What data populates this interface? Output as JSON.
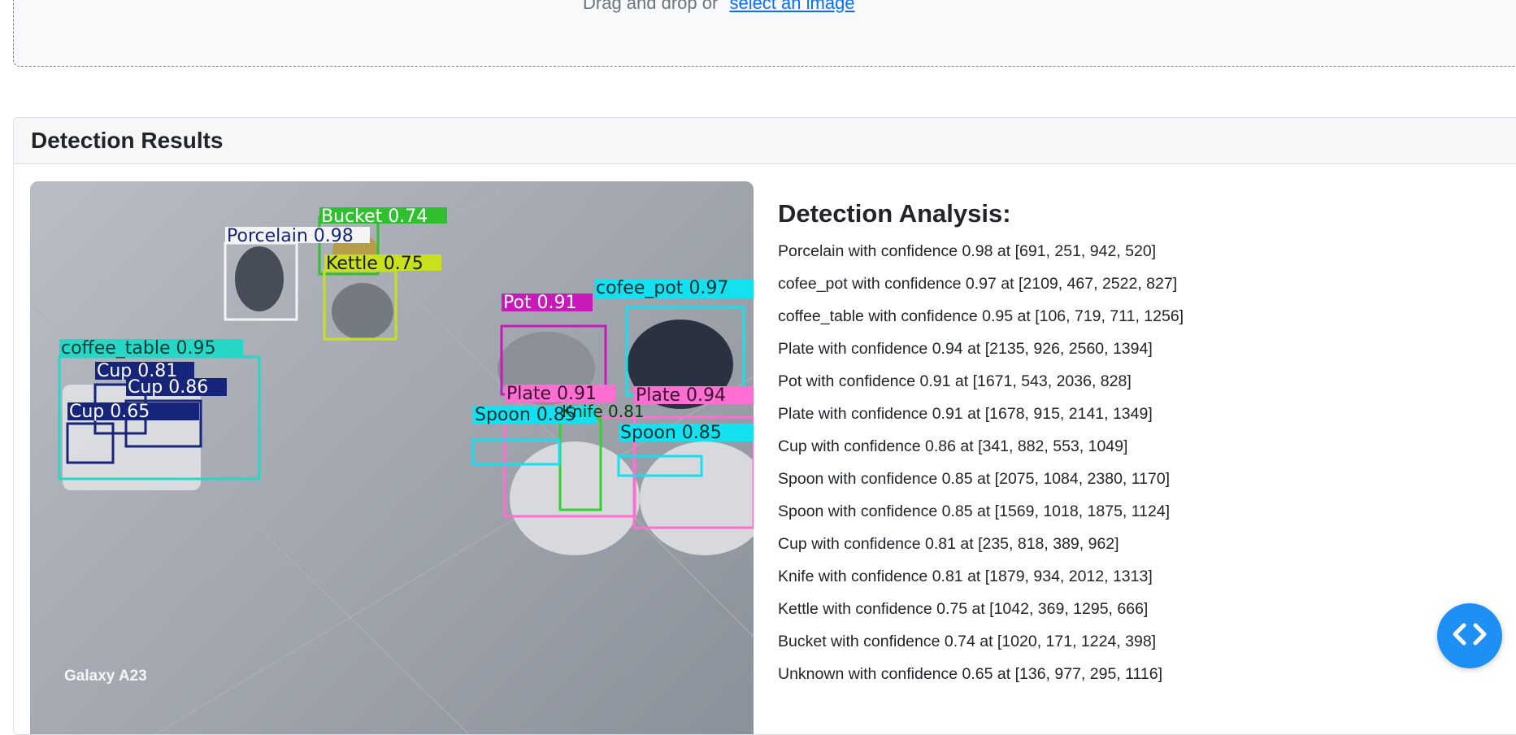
{
  "upload": {
    "text": "Drag and drop or",
    "link_label": "select an image"
  },
  "results": {
    "title": "Detection Results",
    "image_watermark": "Galaxy A23",
    "image_labels": {
      "porcelain": "Porcelain 0.98",
      "bucket": "Bucket 0.74",
      "kettle": "Kettle 0.75",
      "coffee_table": "coffee_table 0.95",
      "cup1": "Cup 0.81",
      "cup2": "Cup 0.86",
      "cup3": "Cup 0.65",
      "pot": "Pot 0.91",
      "cofee_pot": "cofee_pot 0.97",
      "plate1": "Plate 0.91",
      "plate2": "Plate 0.94",
      "knife": "Knife 0.81",
      "spoon1": "Spoon 0.85",
      "spoon2": "Spoon 0.85"
    }
  },
  "analysis": {
    "title": "Detection Analysis:",
    "items": [
      "Porcelain with confidence 0.98 at [691, 251, 942, 520]",
      "cofee_pot with confidence 0.97 at [2109, 467, 2522, 827]",
      "coffee_table with confidence 0.95 at [106, 719, 711, 1256]",
      "Plate with confidence 0.94 at [2135, 926, 2560, 1394]",
      "Pot with confidence 0.91 at [1671, 543, 2036, 828]",
      "Plate with confidence 0.91 at [1678, 915, 2141, 1349]",
      "Cup with confidence 0.86 at [341, 882, 553, 1049]",
      "Spoon with confidence 0.85 at [2075, 1084, 2380, 1170]",
      "Spoon with confidence 0.85 at [1569, 1018, 1875, 1124]",
      "Cup with confidence 0.81 at [235, 818, 389, 962]",
      "Knife with confidence 0.81 at [1879, 934, 2012, 1313]",
      "Kettle with confidence 0.75 at [1042, 369, 1295, 666]",
      "Bucket with confidence 0.74 at [1020, 171, 1224, 398]",
      "Unknown with confidence 0.65 at [136, 977, 295, 1116]"
    ]
  },
  "colors": {
    "link": "#0d6efd",
    "fab": "#1e90f5"
  },
  "icons": {
    "fab": "code-icon"
  }
}
